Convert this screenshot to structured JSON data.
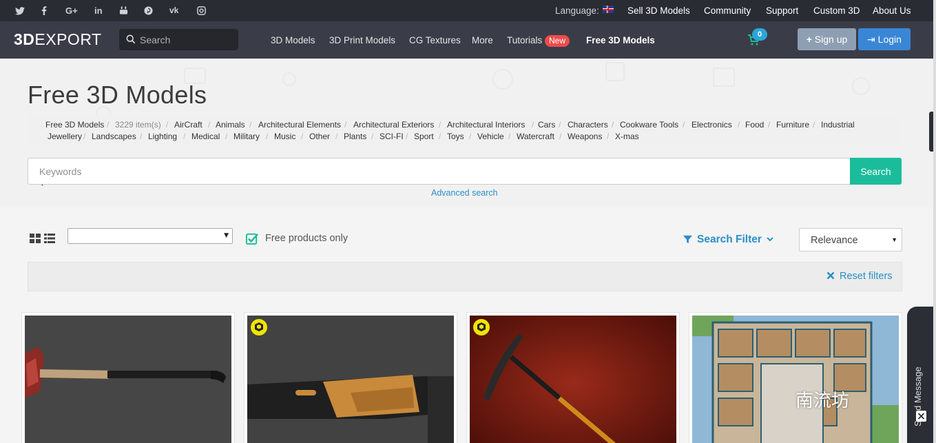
{
  "topbar": {
    "social": [
      {
        "name": "twitter-icon",
        "glyph": "t"
      },
      {
        "name": "facebook-icon",
        "glyph": "f"
      },
      {
        "name": "google-plus-icon",
        "glyph": "G+"
      },
      {
        "name": "linkedin-icon",
        "glyph": "in"
      },
      {
        "name": "youtube-icon",
        "glyph": "▶"
      },
      {
        "name": "pinterest-icon",
        "glyph": "P"
      },
      {
        "name": "vk-icon",
        "glyph": "vk"
      },
      {
        "name": "instagram-icon",
        "glyph": "◎"
      }
    ],
    "language_label": "Language:",
    "links": [
      "Sell 3D Models",
      "Community",
      "Support",
      "Custom 3D",
      "About Us"
    ]
  },
  "header": {
    "logo_bold": "3D",
    "logo_rest": "EXPORT",
    "search_placeholder": "Search",
    "nav": [
      "3D Models",
      "3D Print Models",
      "CG Textures",
      "More",
      "Tutorials",
      "Free 3D Models"
    ],
    "new_badge": "New",
    "cart_count": "0",
    "signup_label": "Sign up",
    "login_label": "Login"
  },
  "hero": {
    "title": "Free 3D Models",
    "breadcrumb_root": "Free 3D Models",
    "item_count": "3229 item(s)",
    "categories_row1": [
      "AirCraft",
      "Animals",
      "Architectural Elements",
      "Architectural Exteriors",
      "Architectural Interiors",
      "Cars",
      "Characters",
      "Cookware Tools",
      "Electronics",
      "Food",
      "Furniture",
      "Industrial"
    ],
    "categories_row2": [
      "Jewellery",
      "Landscapes",
      "Lighting",
      "Medical",
      "Military",
      "Music",
      "Other",
      "Plants",
      "SCI-FI",
      "Sport",
      "Toys",
      "Vehicle",
      "Watercraft",
      "Weapons",
      "X-mas"
    ],
    "keywords_placeholder": "Keywords",
    "search_button": "Search",
    "advanced_search": "Advanced search"
  },
  "filters": {
    "category_select_value": "",
    "free_only_label": "Free products only",
    "search_filter_label": "Search Filter",
    "sort_value": "Relevance",
    "reset_label": "Reset filters"
  },
  "side": {
    "send_message": "Send Message",
    "watermark": "南流坊"
  },
  "colors": {
    "topbar": "#2a2c34",
    "header": "#3a3d48",
    "accent_teal": "#1bbc9b",
    "link_blue": "#2a8fc7",
    "new_badge": "#ef4b4b",
    "login": "#3a86d6",
    "signup": "#8f9fb3"
  }
}
